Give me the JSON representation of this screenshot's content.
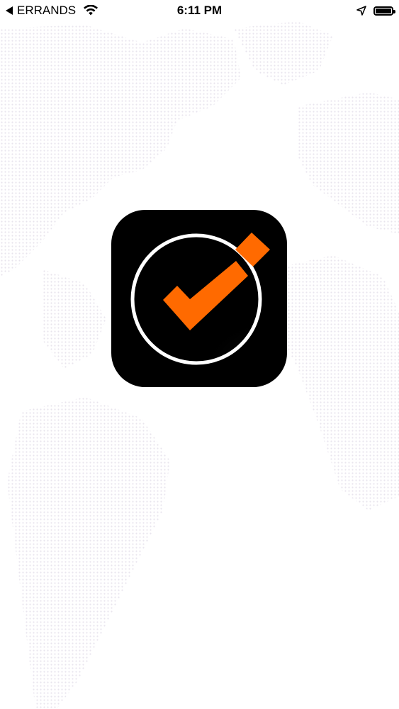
{
  "status_bar": {
    "back_label": "ERRANDS",
    "time": "6:11 PM",
    "icons": [
      "back-arrow-icon",
      "wifi-icon",
      "location-arrow-icon",
      "battery-icon"
    ]
  },
  "splash": {
    "logo_icon": "checkmark-circle-logo-icon"
  },
  "colors": {
    "accent": "#FF6A00",
    "icon_background": "#000000",
    "map_dots": "#E9E6EE",
    "background": "#FFFFFF"
  }
}
